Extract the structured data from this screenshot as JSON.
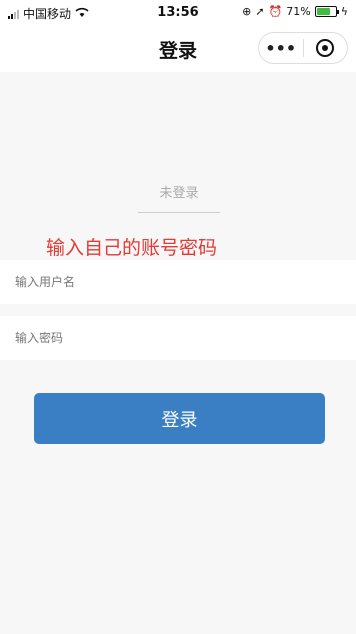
{
  "status_bar": {
    "carrier": "中国移动",
    "time": "13:56",
    "battery": "71%",
    "battery_level": 0.71
  },
  "nav": {
    "title": "登录",
    "more_label": "•••"
  },
  "login": {
    "status": "未登录",
    "annotation": "输入自己的账号密码",
    "username_placeholder": "输入用户名",
    "password_placeholder": "输入密码",
    "submit_label": "登录"
  },
  "colors": {
    "accent": "#3a7fc4",
    "annotation": "#e53935",
    "battery": "#3fbf3f"
  }
}
